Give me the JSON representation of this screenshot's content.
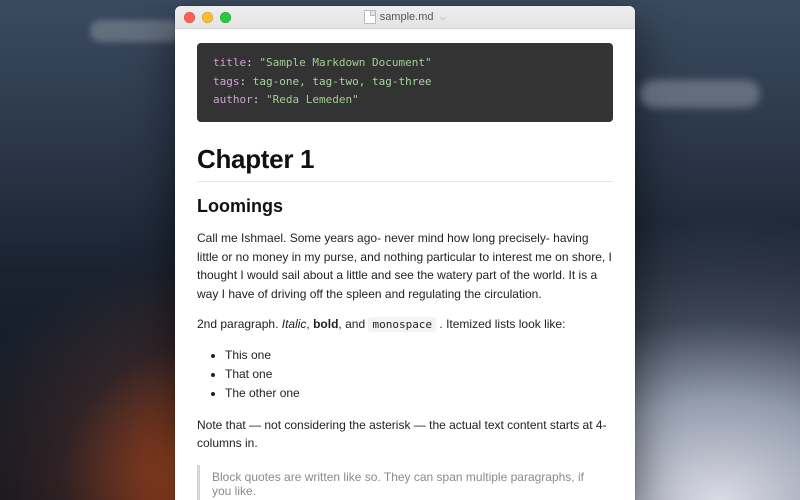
{
  "window": {
    "filename": "sample.md"
  },
  "frontmatter": {
    "rows": [
      {
        "key": "title",
        "value": "\"Sample Markdown Document\"",
        "quoted": true
      },
      {
        "key": "tags",
        "value": "tag-one, tag-two, tag-three",
        "quoted": false
      },
      {
        "key": "author",
        "value": "\"Reda Lemeden\"",
        "quoted": true
      }
    ]
  },
  "doc": {
    "h1": "Chapter 1",
    "h2": "Loomings",
    "p1": "Call me Ishmael. Some years ago- never mind how long precisely- having little or no money in my purse, and nothing particular to interest me on shore, I thought I would sail about a little and see the watery part of the world. It is a way I have of driving off the spleen and regulating the circulation.",
    "p2_pre": "2nd paragraph. ",
    "p2_italic": "Italic",
    "p2_mid1": ", ",
    "p2_bold": "bold",
    "p2_mid2": ", and ",
    "p2_mono": "monospace",
    "p2_post": " . Itemized lists look like:",
    "list": [
      "This one",
      "That one",
      "The other one"
    ],
    "p3": "Note that — not considering the asterisk — the actual text content starts at 4-columns in.",
    "blockquote": "Block quotes are written like so. They can span multiple paragraphs, if you like."
  }
}
